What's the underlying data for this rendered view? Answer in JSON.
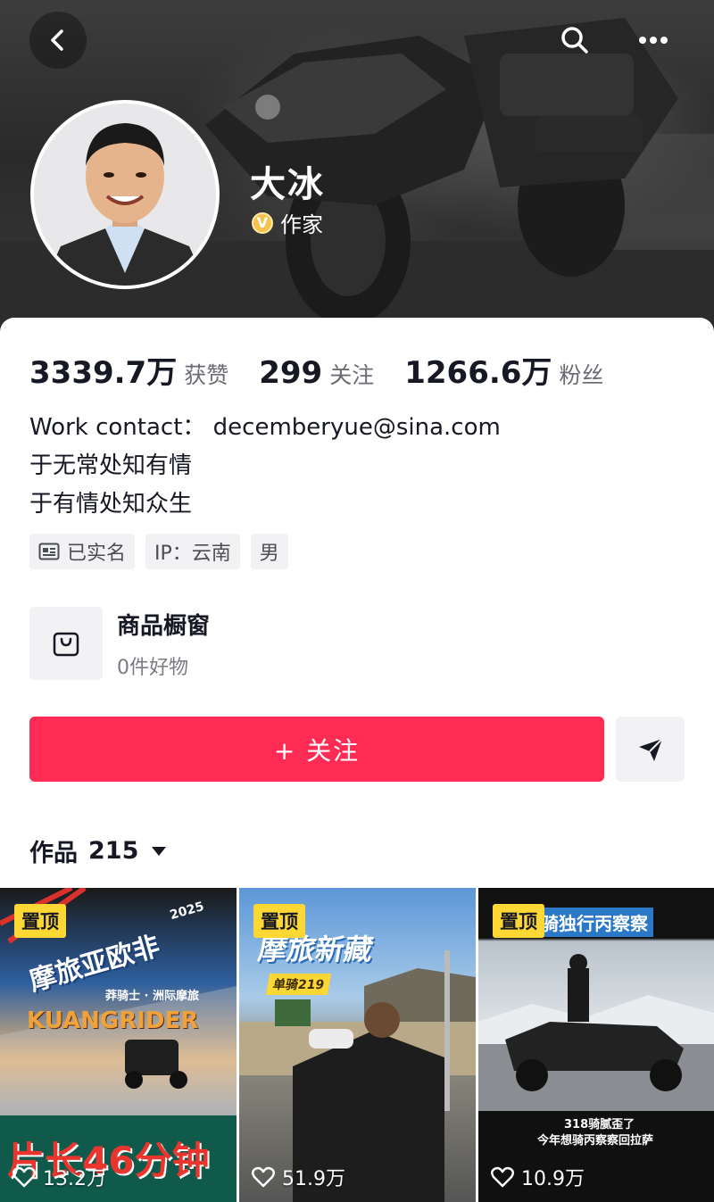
{
  "profile": {
    "name": "大冰",
    "verified_label": "作家",
    "verified_badge": "V"
  },
  "stats": [
    {
      "value": "3339.7万",
      "label": "获赞"
    },
    {
      "value": "299",
      "label": "关注"
    },
    {
      "value": "1266.6万",
      "label": "粉丝"
    }
  ],
  "bio": {
    "line1": "Work contact： decemberyue@sina.com",
    "line2": "于无常处知有情",
    "line3": "于有情处知众生"
  },
  "tags": {
    "real_name": "已实名",
    "ip": "IP：云南",
    "gender": "男"
  },
  "shop": {
    "title": "商品橱窗",
    "subtitle": "0件好物"
  },
  "actions": {
    "follow_label": "+ 关注"
  },
  "works": {
    "label": "作品",
    "count": "215"
  },
  "videos": [
    {
      "pin": "置顶",
      "likes": "13.2万",
      "title_text": "摩旅亚欧非",
      "year": "2025",
      "subtitle": "莽骑士 · 洲际摩旅",
      "brand": "KUANGRIDER",
      "bottom_text": "片长46分钟"
    },
    {
      "pin": "置顶",
      "likes": "51.9万",
      "title_text": "摩旅新藏",
      "tag": "单骑219"
    },
    {
      "pin": "置顶",
      "likes": "10.9万",
      "title_text": "骑独行丙察察",
      "caption1": "318骑腻歪了",
      "caption2": "今年想骑丙察察回拉萨"
    }
  ],
  "colors": {
    "accent": "#fe2c55",
    "pin": "#fdd835",
    "badge": "#f5c34b"
  },
  "icons": [
    "back-icon",
    "search-icon",
    "more-icon",
    "id-card-icon",
    "shop-bag-icon",
    "share-icon",
    "caret-down-icon",
    "heart-icon"
  ]
}
